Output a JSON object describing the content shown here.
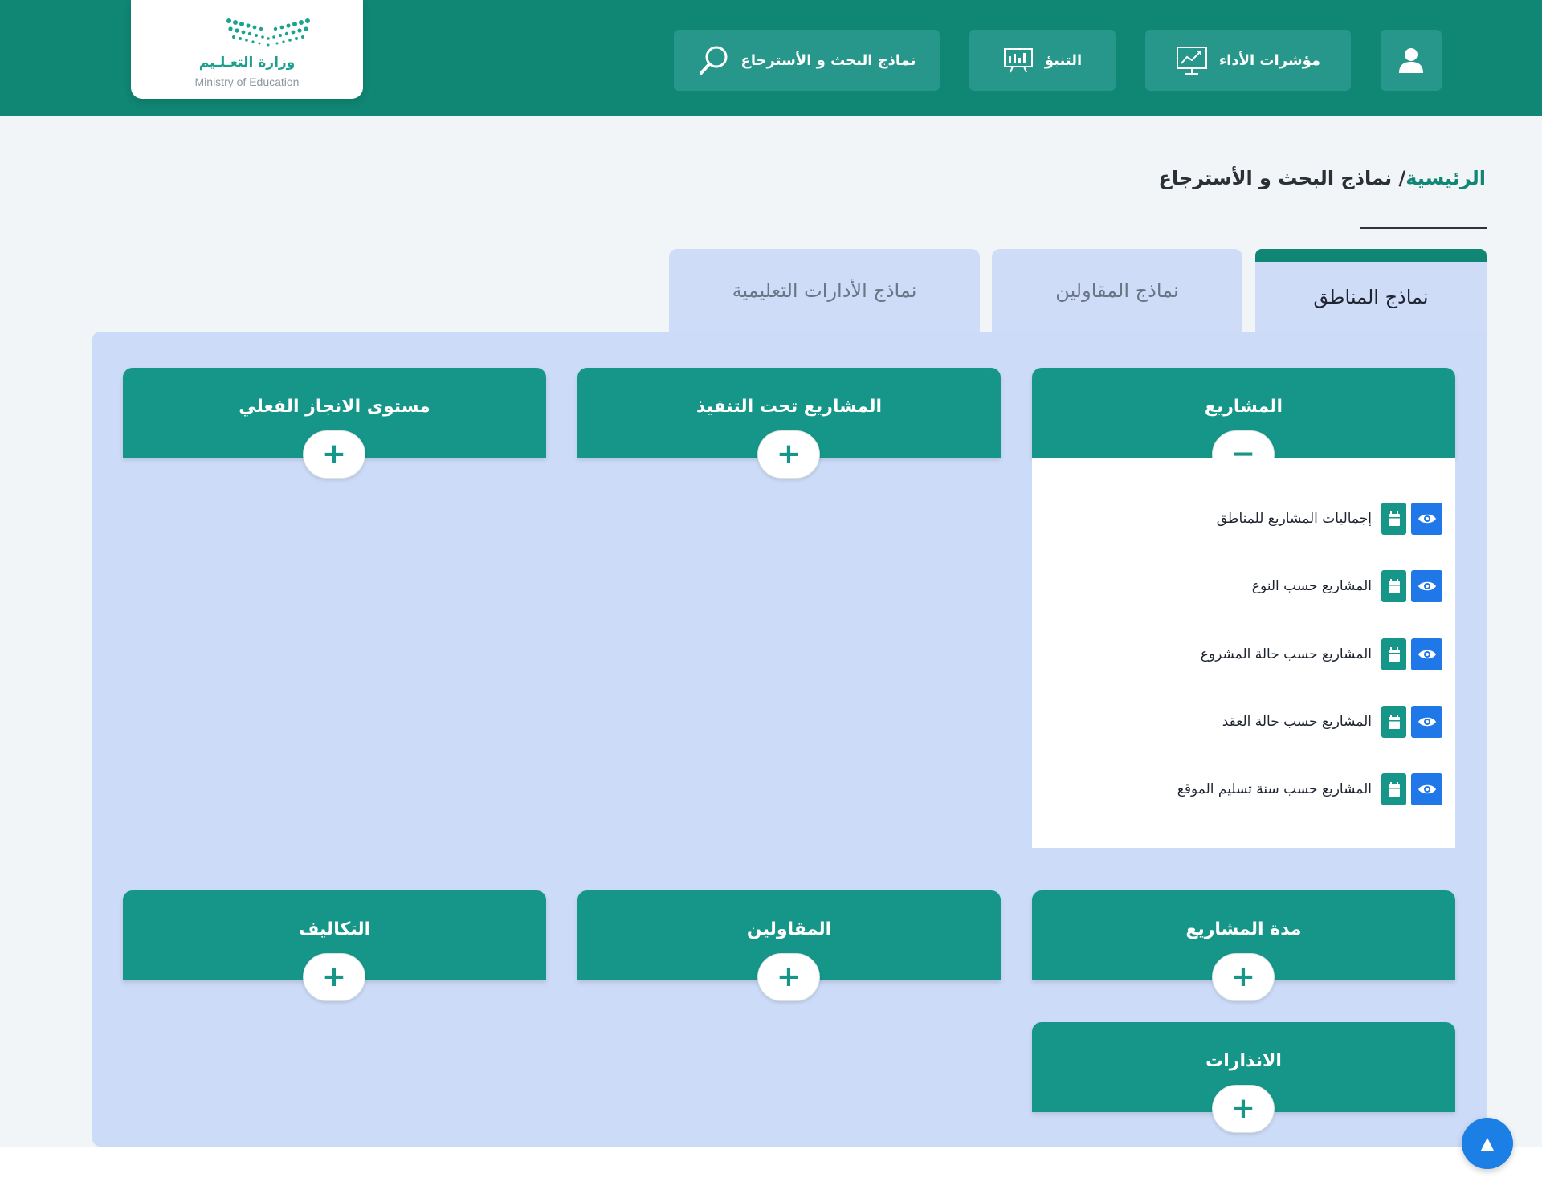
{
  "header": {
    "logo_text_ar": "وزارة التعـلـيم",
    "logo_text_en": "Ministry of Education",
    "nav": {
      "performance_label": "مؤشرات الأداء",
      "prediction_label": "التنبؤ",
      "search_models_label": "نماذج البحث و الأسترجاع"
    },
    "user_icon": "user-icon"
  },
  "breadcrumb": {
    "home": "الرئيسية",
    "separator": "/",
    "current": "نماذج البحث و الأسترجاع"
  },
  "tabs": [
    {
      "label": "نماذج المناطق",
      "active": true
    },
    {
      "label": "نماذج المقاولين",
      "active": false
    },
    {
      "label": "نماذج الأدارات التعليمية",
      "active": false
    }
  ],
  "cards": {
    "projects": {
      "title": "المشاريع",
      "expanded": true,
      "toggle_symbol": "−"
    },
    "under_execution": {
      "title": "المشاريع تحت التنفيذ",
      "expanded": false,
      "toggle_symbol": "+"
    },
    "achievement_level": {
      "title": "مستوى الانجاز الفعلي",
      "expanded": false,
      "toggle_symbol": "+"
    },
    "project_duration": {
      "title": "مدة المشاريع",
      "expanded": false,
      "toggle_symbol": "+"
    },
    "contractors": {
      "title": "المقاولين",
      "expanded": false,
      "toggle_symbol": "+"
    },
    "costs": {
      "title": "التكاليف",
      "expanded": false,
      "toggle_symbol": "+"
    },
    "warnings": {
      "title": "الانذارات",
      "expanded": false,
      "toggle_symbol": "+"
    }
  },
  "projects_reports": [
    "إجماليات المشاريع للمناطق",
    "المشاريع حسب النوع",
    "المشاريع حسب حالة المشروع",
    "المشاريع حسب حالة العقد",
    "المشاريع حسب سنة تسليم الموقع"
  ],
  "colors": {
    "header_bg": "#108674",
    "nav_button_bg": "#26978a",
    "card_header_bg": "#159688",
    "panel_bg": "#ccdbf8",
    "eye_button_bg": "#1f77e8",
    "accent_link": "#108674"
  },
  "scroll_top_icon": "▲"
}
